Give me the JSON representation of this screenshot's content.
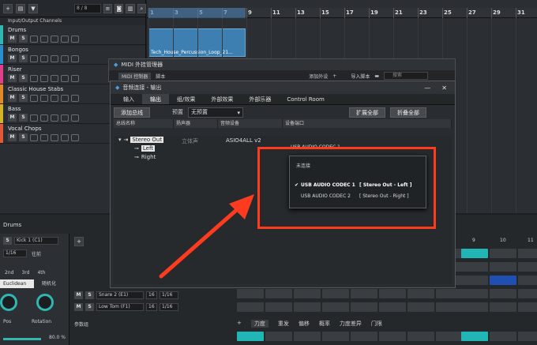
{
  "tracklist": {
    "counter": "8 / 8",
    "group": "Input/Output Channels",
    "tracks": [
      {
        "name": "Drums",
        "color": "#2fb7b0"
      },
      {
        "name": "Bongos",
        "color": "#2a8fd1"
      },
      {
        "name": "Riser",
        "color": "#e0408a"
      },
      {
        "name": "Classic House Stabs",
        "color": "#e08a2a"
      },
      {
        "name": "Bass",
        "color": "#d2b32a"
      },
      {
        "name": "Vocal Chops",
        "color": "#e05a3a"
      }
    ],
    "mute": "M",
    "solo": "S"
  },
  "ruler": {
    "marks": [
      "1",
      "3",
      "5",
      "7",
      "9",
      "11",
      "13",
      "15",
      "17",
      "19",
      "21",
      "23",
      "25",
      "27",
      "29",
      "31"
    ]
  },
  "clip": {
    "label": "Tech_House_Percussion_Loop_21..."
  },
  "midi_window": {
    "title": "MIDI 外挂管理器",
    "tab_a": "MIDI 控制器",
    "tab_b": "脚本",
    "add_device": "添加外设",
    "import_script": "导入脚本",
    "search_placeholder": "搜索"
  },
  "audio_window": {
    "title": "音频连接 - 输出",
    "tabs": [
      "输入",
      "输出",
      "组/效果",
      "外部效果",
      "外部乐器",
      "Control Room"
    ],
    "active_tab": 1,
    "add_bus": "添加总线",
    "preset_label": "预置",
    "preset_value": "无预置",
    "expand_all": "扩展全部",
    "collapse_all": "折叠全部",
    "columns": [
      "总线名称",
      "扬声器",
      "音频设备",
      "设备端口"
    ],
    "bus_name": "Stereo Out",
    "speaker": "立体声",
    "device": "ASIO4ALL v2",
    "port_partial": "USB AUDIO CODEC 1",
    "channels": [
      "Left",
      "Right"
    ]
  },
  "popup": {
    "header": "未连接",
    "options": [
      {
        "name": "USB AUDIO  CODEC 1",
        "port": "[ Stereo Out - Left ]",
        "selected": true
      },
      {
        "name": "USB AUDIO  CODEC 2",
        "port": "[ Stereo Out - Right ]",
        "selected": false
      }
    ]
  },
  "bottom": {
    "title": "Drums",
    "kick_label": "Kick 1 (C1)",
    "rate": "1/16",
    "advance": "往前",
    "mode": "Euclidean",
    "randomize": "随机化",
    "steps": [
      "2nd",
      "3rd",
      "4th"
    ],
    "lanes": [
      {
        "name": "Snare 2 (E1)",
        "rate": "1/16",
        "steps": "16"
      },
      {
        "name": "Low Tom (F1)",
        "rate": "1/16",
        "steps": "16"
      }
    ],
    "knob_a": "Pos",
    "knob_b": "Rotation",
    "zoom": "80.0 %",
    "params": "参数组",
    "tabs": [
      "力度",
      "重发",
      "偏移",
      "概率",
      "力度差异",
      "门限"
    ],
    "col9": "9",
    "col10": "10",
    "col11": "11"
  },
  "colors": {
    "accent": "#2fb7b0",
    "highlight": "#ff3b1f",
    "pad_active": "#22b5b5",
    "pad_blue": "#1f4fb0"
  }
}
